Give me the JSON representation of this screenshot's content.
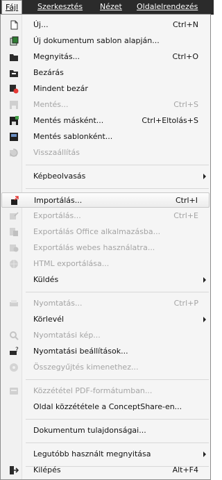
{
  "menubar": {
    "file": "Fájl",
    "edit": "Szerkesztés",
    "view": "Nézet",
    "page": "Oldalelrendezés"
  },
  "menu": {
    "items": [
      {
        "label": "Új...",
        "shortcut": "Ctrl+N",
        "disabled": false,
        "icon": "new-document-icon"
      },
      {
        "label": "Új dokumentum sablon alapján...",
        "shortcut": "",
        "disabled": false,
        "icon": "new-from-template-icon"
      },
      {
        "label": "Megnyitás...",
        "shortcut": "Ctrl+O",
        "disabled": false,
        "icon": "open-folder-icon"
      },
      {
        "label": "Bezárás",
        "shortcut": "",
        "disabled": false,
        "icon": "close-document-icon"
      },
      {
        "label": "Mindent bezár",
        "shortcut": "",
        "disabled": false,
        "icon": "close-all-icon"
      },
      {
        "label": "Mentés...",
        "shortcut": "Ctrl+S",
        "disabled": true,
        "icon": "save-icon"
      },
      {
        "label": "Mentés másként...",
        "shortcut": "Ctrl+Eltolás+S",
        "disabled": false,
        "icon": "save-as-icon"
      },
      {
        "label": "Mentés sablonként...",
        "shortcut": "",
        "disabled": false,
        "icon": "save-as-template-icon"
      },
      {
        "label": "Visszaállítás",
        "shortcut": "",
        "disabled": true,
        "icon": "revert-icon"
      },
      {
        "label": "Képbeolvasás",
        "shortcut": "",
        "disabled": false,
        "submenu": true
      },
      {
        "label": "Importálás...",
        "shortcut": "Ctrl+I",
        "disabled": false,
        "icon": "import-icon",
        "highlighted": true
      },
      {
        "label": "Exportálás...",
        "shortcut": "Ctrl+E",
        "disabled": true,
        "icon": "export-icon"
      },
      {
        "label": "Exportálás Office alkalmazásba...",
        "shortcut": "",
        "disabled": true,
        "icon": "export-office-icon"
      },
      {
        "label": "Exportálás webes használatra...",
        "shortcut": "",
        "disabled": true,
        "icon": "export-web-icon"
      },
      {
        "label": "HTML exportálása...",
        "shortcut": "",
        "disabled": true,
        "icon": "export-html-icon"
      },
      {
        "label": "Küldés",
        "shortcut": "",
        "disabled": false,
        "submenu": true
      },
      {
        "label": "Nyomtatás...",
        "shortcut": "Ctrl+P",
        "disabled": true,
        "icon": "print-icon"
      },
      {
        "label": "Körlevél",
        "shortcut": "",
        "disabled": false,
        "submenu": true
      },
      {
        "label": "Nyomtatási kép...",
        "shortcut": "",
        "disabled": true,
        "icon": "print-preview-icon"
      },
      {
        "label": "Nyomtatási beállítások...",
        "shortcut": "",
        "disabled": false,
        "icon": "print-setup-icon"
      },
      {
        "label": "Összegyűjtés kimenethez...",
        "shortcut": "",
        "disabled": true,
        "icon": "collect-output-icon"
      },
      {
        "label": "Közzététel PDF-formátumban...",
        "shortcut": "",
        "disabled": true,
        "icon": "publish-pdf-icon"
      },
      {
        "label": "Oldal közzététele a ConceptShare-en...",
        "shortcut": "",
        "disabled": false
      },
      {
        "label": "Dokumentum tulajdonságai...",
        "shortcut": "",
        "disabled": false
      },
      {
        "label": "Legutóbb használt megnyitása",
        "shortcut": "",
        "disabled": false,
        "submenu": true
      },
      {
        "label": "Kilépés",
        "shortcut": "Alt+F4",
        "disabled": false,
        "icon": "exit-icon"
      }
    ]
  }
}
